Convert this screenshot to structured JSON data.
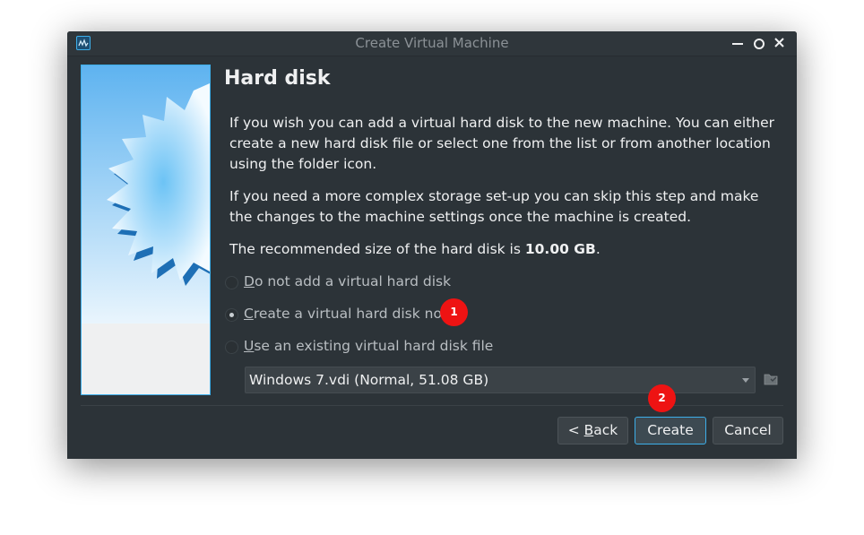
{
  "window": {
    "title": "Create Virtual Machine"
  },
  "page": {
    "heading": "Hard disk",
    "paragraph1": "If you wish you can add a virtual hard disk to the new machine. You can either create a new hard disk file or select one from the list or from another location using the folder icon.",
    "paragraph2": "If you need a more complex storage set-up you can skip this step and make the changes to the machine settings once the machine is created.",
    "recommended_prefix": "The recommended size of the hard disk is ",
    "recommended_size": "10.00 GB",
    "recommended_suffix": "."
  },
  "options": [
    {
      "mnemonic": "D",
      "rest": "o not add a virtual hard disk",
      "selected": false
    },
    {
      "mnemonic": "C",
      "rest": "reate a virtual hard disk now",
      "selected": true
    },
    {
      "mnemonic": "U",
      "rest": "se an existing virtual hard disk file",
      "selected": false
    }
  ],
  "disk_select": {
    "value": "Windows 7.vdi (Normal, 51.08 GB)"
  },
  "buttons": {
    "back_prefix": "< ",
    "back_mnemonic": "B",
    "back_rest": "ack",
    "create": "Create",
    "cancel": "Cancel"
  },
  "markers": {
    "m1": "1",
    "m2": "2"
  },
  "colors": {
    "accent": "#3daee9",
    "window_bg": "#2c3338",
    "marker": "#ee1313"
  },
  "icons": {
    "app": "virtualbox-icon",
    "minimize": "minimize-icon",
    "maximize": "maximize-icon",
    "close": "close-icon",
    "folder": "folder-icon",
    "dropdown": "chevron-down-icon"
  }
}
